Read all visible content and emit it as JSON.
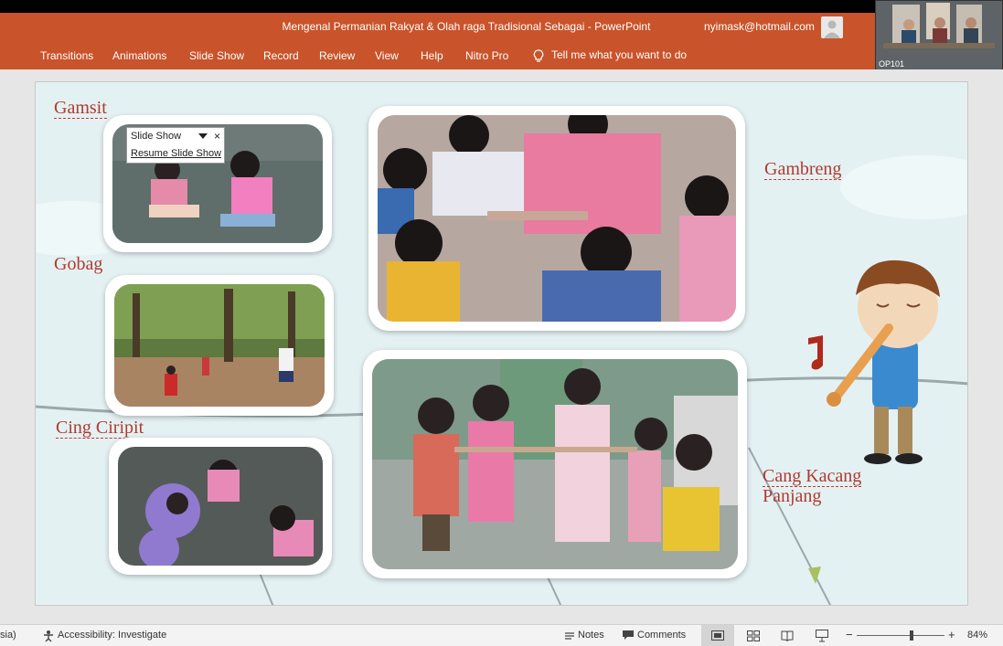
{
  "window": {
    "doc_title": "Mengenal Permanian Rakyat & Olah raga Tradisional Sebagai  -  PowerPoint",
    "user_email": "nyimask@hotmail.com"
  },
  "ribbon": {
    "tabs": [
      "Transitions",
      "Animations",
      "Slide Show",
      "Record",
      "Review",
      "View",
      "Help",
      "Nitro Pro"
    ],
    "tell_me": "Tell me what you want to do"
  },
  "video": {
    "label": "OP101"
  },
  "popup": {
    "title": "Slide Show",
    "item": "Resume Slide Show",
    "close": "×"
  },
  "slide": {
    "labels": {
      "gamsit": "Gamsit",
      "gobag": "Gobag",
      "cing_ciripit": "Cing Ciripit",
      "gambreng": "Gambreng",
      "cang_kacang_line1": "Cang Kacang",
      "cang_kacang_line2": "Panjang"
    }
  },
  "statusbar": {
    "language": "sia)",
    "accessibility": "Accessibility: Investigate",
    "notes": "Notes",
    "comments": "Comments",
    "zoom": "84%",
    "zoom_level": 0.84
  },
  "colors": {
    "ribbon": "#c9532a",
    "label": "#b03a2e",
    "slide_bg": "#e4f1f3"
  }
}
